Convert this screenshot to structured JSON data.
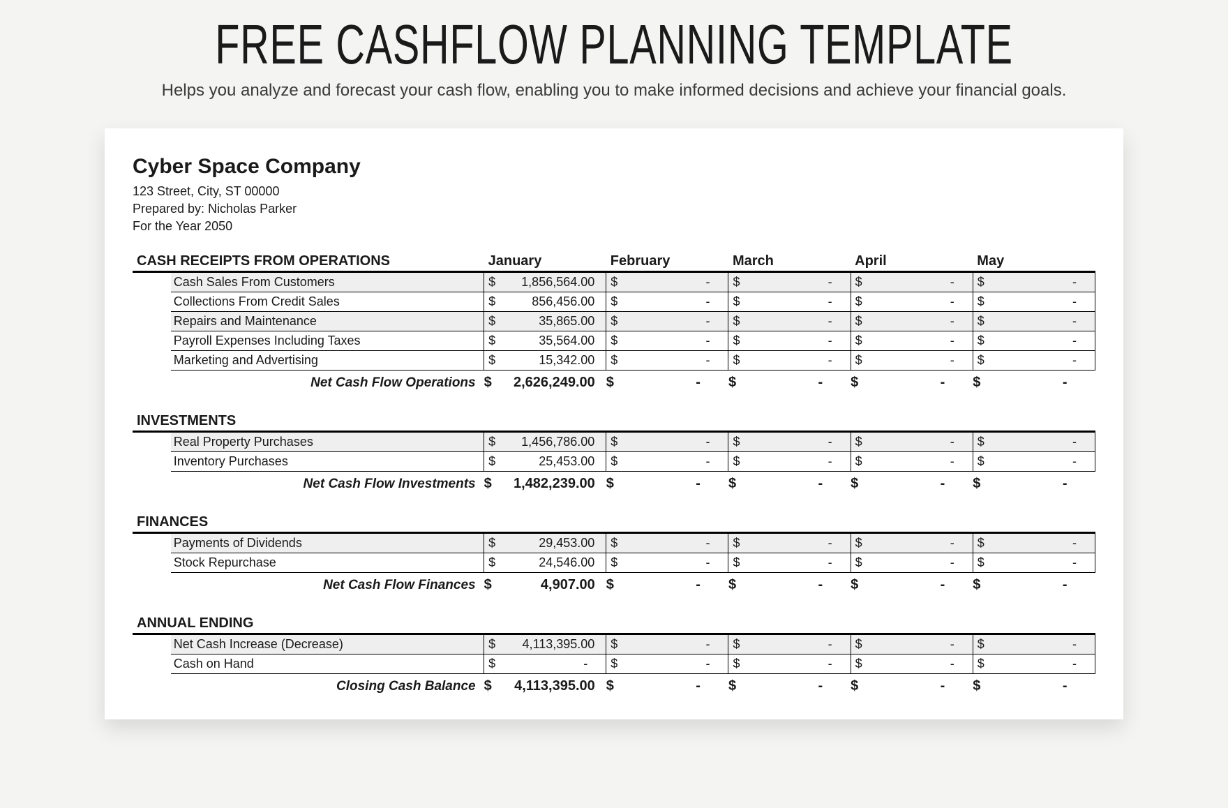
{
  "header": {
    "title": "FREE CASHFLOW PLANNING TEMPLATE",
    "subtitle": "Helps you analyze and forecast your cash flow,  enabling you to make informed decisions and achieve your financial goals."
  },
  "company": {
    "name": "Cyber Space Company",
    "address": "123 Street, City, ST  00000",
    "prepared_by": "Prepared by: Nicholas Parker",
    "period": "For the Year 2050"
  },
  "months": [
    "January",
    "February",
    "March",
    "April",
    "May"
  ],
  "currency": "$",
  "dash": "-",
  "sections": [
    {
      "title": "CASH RECEIPTS FROM OPERATIONS",
      "show_months_header": true,
      "rows": [
        {
          "label": "Cash Sales From Customers",
          "shaded": true,
          "values": [
            "1,856,564.00",
            "-",
            "-",
            "-",
            "-"
          ]
        },
        {
          "label": "Collections From Credit Sales",
          "shaded": false,
          "values": [
            "856,456.00",
            "-",
            "-",
            "-",
            "-"
          ]
        },
        {
          "label": "Repairs and  Maintenance",
          "shaded": true,
          "values": [
            "35,865.00",
            "-",
            "-",
            "-",
            "-"
          ]
        },
        {
          "label": "Payroll Expenses Including Taxes",
          "shaded": false,
          "values": [
            "35,564.00",
            "-",
            "-",
            "-",
            "-"
          ]
        },
        {
          "label": "Marketing and Advertising",
          "shaded": false,
          "values": [
            "15,342.00",
            "-",
            "-",
            "-",
            "-"
          ]
        }
      ],
      "total_label": "Net Cash Flow Operations",
      "total_values": [
        "2,626,249.00",
        "-",
        "-",
        "-",
        "-"
      ]
    },
    {
      "title": "INVESTMENTS",
      "rows": [
        {
          "label": "Real Property Purchases",
          "shaded": true,
          "values": [
            "1,456,786.00",
            "-",
            "-",
            "-",
            "-"
          ]
        },
        {
          "label": "Inventory Purchases",
          "shaded": false,
          "values": [
            "25,453.00",
            "-",
            "-",
            "-",
            "-"
          ]
        }
      ],
      "total_label": "Net Cash Flow Investments",
      "total_values": [
        "1,482,239.00",
        "-",
        "-",
        "-",
        "-"
      ]
    },
    {
      "title": "FINANCES",
      "rows": [
        {
          "label": "Payments of Dividends",
          "shaded": true,
          "values": [
            "29,453.00",
            "-",
            "-",
            "-",
            "-"
          ]
        },
        {
          "label": "Stock Repurchase",
          "shaded": false,
          "values": [
            "24,546.00",
            "-",
            "-",
            "-",
            "-"
          ]
        }
      ],
      "total_label": "Net Cash Flow Finances",
      "total_values": [
        "4,907.00",
        "-",
        "-",
        "-",
        "-"
      ]
    },
    {
      "title": "ANNUAL ENDING",
      "rows": [
        {
          "label": "Net Cash Increase (Decrease)",
          "shaded": true,
          "values": [
            "4,113,395.00",
            "-",
            "-",
            "-",
            "-"
          ]
        },
        {
          "label": "Cash on Hand",
          "shaded": false,
          "values": [
            "-",
            "-",
            "-",
            "-",
            "-"
          ]
        }
      ],
      "total_label": "Closing Cash Balance",
      "total_values": [
        "4,113,395.00",
        "-",
        "-",
        "-",
        "-"
      ]
    }
  ]
}
